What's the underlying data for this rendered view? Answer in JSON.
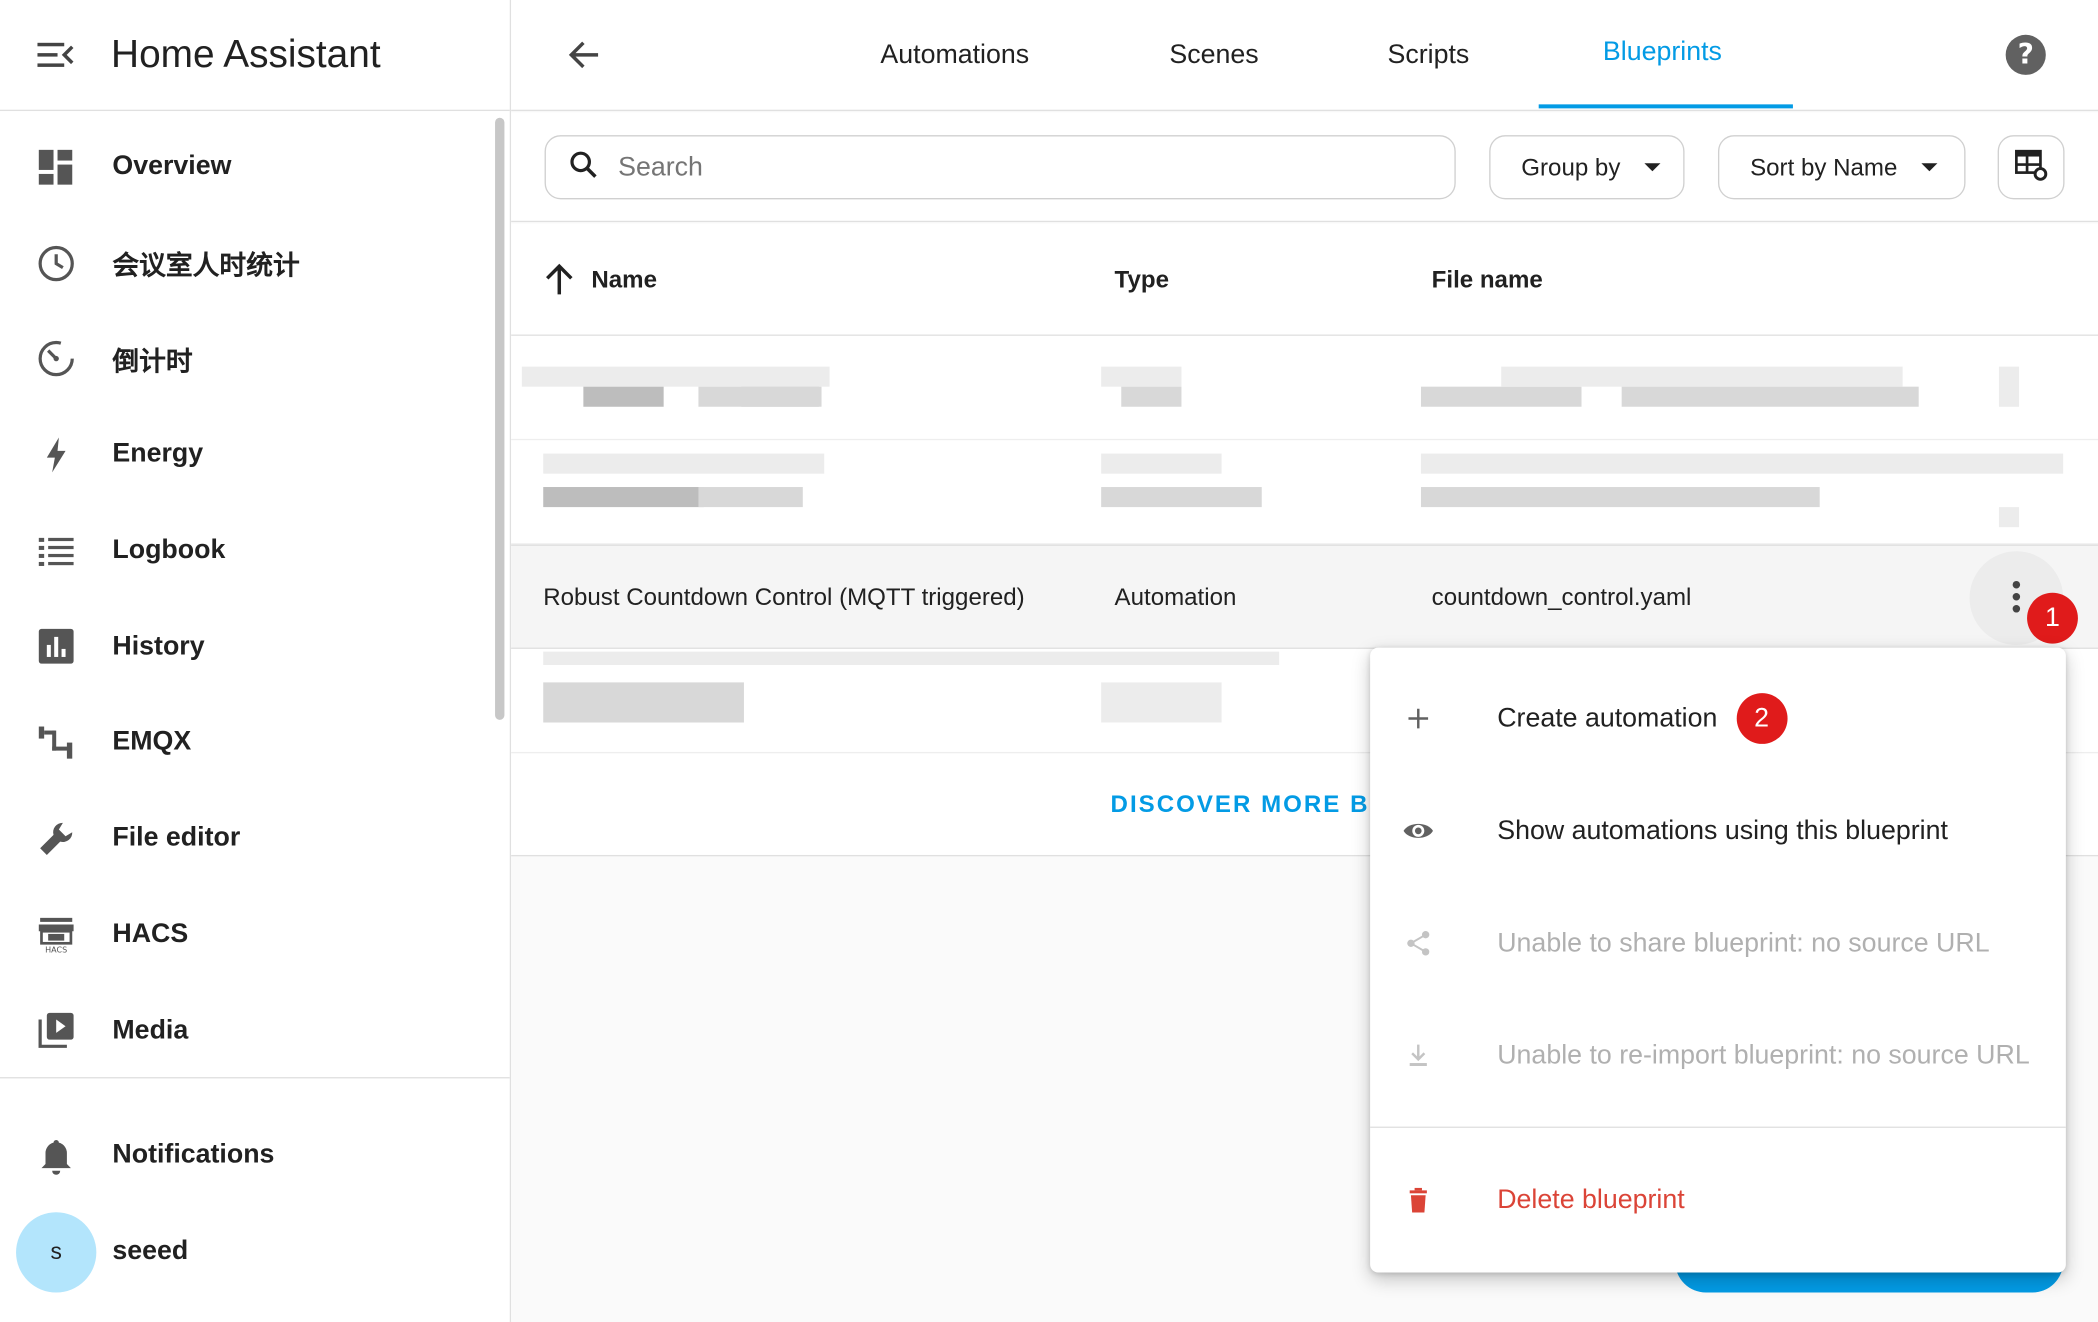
{
  "app": {
    "title": "Home Assistant"
  },
  "sidebar": {
    "items": [
      {
        "label": "Overview",
        "icon": "dashboard-icon"
      },
      {
        "label": "会议室人时统计",
        "icon": "clock-icon"
      },
      {
        "label": "倒计时",
        "icon": "timer-icon"
      },
      {
        "label": "Energy",
        "icon": "lightning-icon"
      },
      {
        "label": "Logbook",
        "icon": "list-icon"
      },
      {
        "label": "History",
        "icon": "chart-box-icon"
      },
      {
        "label": "EMQX",
        "icon": "pipe-icon"
      },
      {
        "label": "File editor",
        "icon": "wrench-icon"
      },
      {
        "label": "HACS",
        "icon": "hacs-store-icon"
      },
      {
        "label": "Media",
        "icon": "media-play-icon"
      }
    ],
    "notifications_label": "Notifications",
    "user": {
      "name": "seeed",
      "initial": "s"
    }
  },
  "tabs": [
    {
      "label": "Automations"
    },
    {
      "label": "Scenes"
    },
    {
      "label": "Scripts"
    },
    {
      "label": "Blueprints",
      "active": true
    }
  ],
  "toolbar": {
    "search_placeholder": "Search",
    "group_by_label": "Group by",
    "sort_label": "Sort by Name"
  },
  "table": {
    "columns": {
      "name": "Name",
      "type": "Type",
      "file": "File name"
    },
    "selected_row": {
      "name": "Robust Countdown Control (MQTT triggered)",
      "type": "Automation",
      "file": "countdown_control.yaml"
    },
    "discover_label": "DISCOVER MORE BL"
  },
  "badges": {
    "first": "1",
    "second": "2"
  },
  "menu": {
    "create": "Create automation",
    "show": "Show automations using this blueprint",
    "share": "Unable to share blueprint: no source URL",
    "reimport": "Unable to re-import blueprint: no source URL",
    "delete": "Delete blueprint"
  },
  "colors": {
    "accent": "#039be5",
    "danger": "#db4437",
    "badge": "#e01b1b",
    "avatar": "#b3e5fc"
  }
}
